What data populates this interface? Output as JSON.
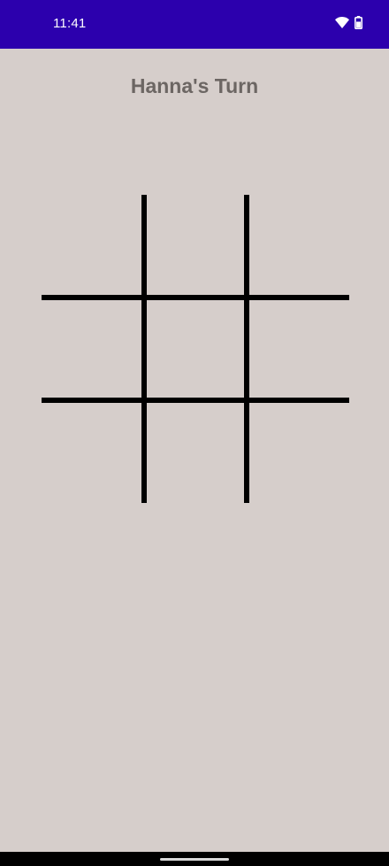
{
  "status_bar": {
    "time": "11:41",
    "background_color": "#2c00ad",
    "icons": [
      "wifi-icon",
      "battery-icon"
    ]
  },
  "game": {
    "turn_text": "Hanna's Turn",
    "board": {
      "rows": 3,
      "cols": 3,
      "cells": [
        "",
        "",
        "",
        "",
        "",
        "",
        "",
        "",
        ""
      ]
    }
  },
  "colors": {
    "background": "#d6cecb",
    "title": "#6c6663",
    "grid_lines": "#000000"
  }
}
